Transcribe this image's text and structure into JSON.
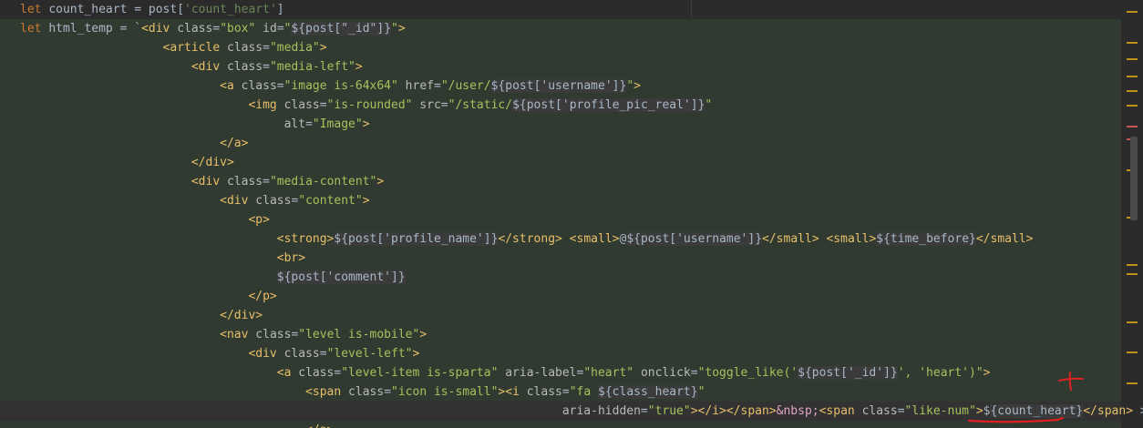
{
  "editor": {
    "lines": [
      [
        [
          "kw",
          "let "
        ],
        [
          "var",
          "count_heart"
        ],
        [
          "pun",
          " = "
        ],
        [
          "var",
          "post"
        ],
        [
          "pun",
          "["
        ],
        [
          "str",
          "'count_heart'"
        ],
        [
          "pun",
          "]"
        ]
      ],
      [
        [
          "kw",
          "let "
        ],
        [
          "var",
          "html_temp"
        ],
        [
          "pun",
          " = `"
        ],
        [
          "tag",
          "<div "
        ],
        [
          "attr",
          "class"
        ],
        [
          "pun",
          "="
        ],
        [
          "val",
          "\"box\""
        ],
        [
          "attr",
          " id"
        ],
        [
          "pun",
          "="
        ],
        [
          "val",
          "\""
        ],
        [
          "sub",
          "${post[\"_id\"]}"
        ],
        [
          "val",
          "\""
        ],
        [
          "tag",
          ">"
        ]
      ],
      [
        [
          "pun",
          "                    "
        ],
        [
          "tag",
          "<article "
        ],
        [
          "attr",
          "class"
        ],
        [
          "pun",
          "="
        ],
        [
          "val",
          "\"media\""
        ],
        [
          "tag",
          ">"
        ]
      ],
      [
        [
          "pun",
          "                        "
        ],
        [
          "tag",
          "<div "
        ],
        [
          "attr",
          "class"
        ],
        [
          "pun",
          "="
        ],
        [
          "val",
          "\"media-left\""
        ],
        [
          "tag",
          ">"
        ]
      ],
      [
        [
          "pun",
          "                            "
        ],
        [
          "tag",
          "<a "
        ],
        [
          "attr",
          "class"
        ],
        [
          "pun",
          "="
        ],
        [
          "val",
          "\"image is-64x64\""
        ],
        [
          "attr",
          " href"
        ],
        [
          "pun",
          "="
        ],
        [
          "val",
          "\"/user/"
        ],
        [
          "sub",
          "${post['username']}"
        ],
        [
          "val",
          "\""
        ],
        [
          "tag",
          ">"
        ]
      ],
      [
        [
          "pun",
          "                                "
        ],
        [
          "tag",
          "<img "
        ],
        [
          "attr",
          "class"
        ],
        [
          "pun",
          "="
        ],
        [
          "val",
          "\"is-rounded\""
        ],
        [
          "attr",
          " src"
        ],
        [
          "pun",
          "="
        ],
        [
          "val",
          "\"/static/"
        ],
        [
          "sub",
          "${post['profile_pic_real']}"
        ],
        [
          "val",
          "\""
        ]
      ],
      [
        [
          "pun",
          "                                     "
        ],
        [
          "attr",
          "alt"
        ],
        [
          "pun",
          "="
        ],
        [
          "val",
          "\"Image\""
        ],
        [
          "tag",
          ">"
        ]
      ],
      [
        [
          "pun",
          "                            "
        ],
        [
          "tag",
          "</a>"
        ]
      ],
      [
        [
          "pun",
          "                        "
        ],
        [
          "tag",
          "</div>"
        ]
      ],
      [
        [
          "pun",
          "                        "
        ],
        [
          "tag",
          "<div "
        ],
        [
          "attr",
          "class"
        ],
        [
          "pun",
          "="
        ],
        [
          "val",
          "\"media-content\""
        ],
        [
          "tag",
          ">"
        ]
      ],
      [
        [
          "pun",
          "                            "
        ],
        [
          "tag",
          "<div "
        ],
        [
          "attr",
          "class"
        ],
        [
          "pun",
          "="
        ],
        [
          "val",
          "\"content\""
        ],
        [
          "tag",
          ">"
        ]
      ],
      [
        [
          "pun",
          "                                "
        ],
        [
          "tag",
          "<p>"
        ]
      ],
      [
        [
          "pun",
          "                                    "
        ],
        [
          "tag",
          "<strong>"
        ],
        [
          "sub",
          "${post['profile_name']}"
        ],
        [
          "tag",
          "</strong>"
        ],
        [
          "pun",
          " "
        ],
        [
          "tag",
          "<small>"
        ],
        [
          "pun",
          "@"
        ],
        [
          "sub",
          "${post['username']}"
        ],
        [
          "tag",
          "</small>"
        ],
        [
          "pun",
          " "
        ],
        [
          "tag",
          "<small>"
        ],
        [
          "sub",
          "${time_before}"
        ],
        [
          "tag",
          "</small>"
        ]
      ],
      [
        [
          "pun",
          "                                    "
        ],
        [
          "tag",
          "<br>"
        ]
      ],
      [
        [
          "pun",
          "                                    "
        ],
        [
          "sub",
          "${post['comment']}"
        ]
      ],
      [
        [
          "pun",
          "                                "
        ],
        [
          "tag",
          "</p>"
        ]
      ],
      [
        [
          "pun",
          "                            "
        ],
        [
          "tag",
          "</div>"
        ]
      ],
      [
        [
          "pun",
          "                            "
        ],
        [
          "tag",
          "<nav "
        ],
        [
          "attr",
          "class"
        ],
        [
          "pun",
          "="
        ],
        [
          "val",
          "\"level is-mobile\""
        ],
        [
          "tag",
          ">"
        ]
      ],
      [
        [
          "pun",
          "                                "
        ],
        [
          "tag",
          "<div "
        ],
        [
          "attr",
          "class"
        ],
        [
          "pun",
          "="
        ],
        [
          "val",
          "\"level-left\""
        ],
        [
          "tag",
          ">"
        ]
      ],
      [
        [
          "pun",
          "                                    "
        ],
        [
          "tag",
          "<a "
        ],
        [
          "attr",
          "class"
        ],
        [
          "pun",
          "="
        ],
        [
          "val",
          "\"level-item is-sparta\""
        ],
        [
          "attr",
          " aria-label"
        ],
        [
          "pun",
          "="
        ],
        [
          "val",
          "\"heart\""
        ],
        [
          "attr",
          " onclick"
        ],
        [
          "pun",
          "="
        ],
        [
          "val",
          "\"toggle_like('"
        ],
        [
          "sub",
          "${post['_id']}"
        ],
        [
          "val",
          "', 'heart')\""
        ],
        [
          "tag",
          ">"
        ]
      ],
      [
        [
          "pun",
          "                                        "
        ],
        [
          "tag",
          "<span "
        ],
        [
          "attr",
          "class"
        ],
        [
          "pun",
          "="
        ],
        [
          "val",
          "\"icon is-small\""
        ],
        [
          "tag",
          ">"
        ],
        [
          "tag",
          "<i "
        ],
        [
          "attr",
          "class"
        ],
        [
          "pun",
          "="
        ],
        [
          "val",
          "\"fa "
        ],
        [
          "sub",
          "${class_heart}"
        ],
        [
          "val",
          "\""
        ]
      ],
      [
        [
          "pun",
          "                                                                            "
        ],
        [
          "attr",
          "aria-hidden"
        ],
        [
          "pun",
          "="
        ],
        [
          "val",
          "\"true\""
        ],
        [
          "tag",
          "></i></span>"
        ],
        [
          "ent",
          "&nbsp;"
        ],
        [
          "tag",
          "<span "
        ],
        [
          "attr",
          "class"
        ],
        [
          "pun",
          "="
        ],
        [
          "val",
          "\"like-num\""
        ],
        [
          "tag",
          ">"
        ],
        [
          "pun",
          "$"
        ],
        [
          "sub",
          "{count_heart}"
        ],
        [
          "tag",
          "</span>"
        ],
        [
          "pun",
          " >"
        ]
      ],
      [
        [
          "pun",
          "                                        "
        ],
        [
          "tag",
          "</a>"
        ]
      ]
    ],
    "line_styles": [
      "plain",
      "tpl",
      "tpl",
      "tpl",
      "tpl",
      "tpl",
      "tpl",
      "tpl",
      "tpl",
      "tpl",
      "tpl",
      "tpl",
      "tpl",
      "tpl",
      "tpl",
      "tpl",
      "tpl",
      "tpl",
      "tpl",
      "tpl",
      "tpl",
      "hl",
      "tpl"
    ],
    "markers": [
      {
        "color": "#be9117"
      },
      {
        "color": "#be9117"
      },
      {
        "color": "#be9117"
      },
      {
        "color": "#be9117"
      },
      {
        "color": "#be9117"
      },
      {
        "color": "#be9117"
      },
      {
        "color": "#c75450"
      },
      {
        "color": "#c75450"
      },
      {
        "color": "#be9117"
      },
      {
        "color": "#be9117"
      },
      {
        "color": "#be9117"
      },
      {
        "color": "#be9117"
      },
      {
        "color": "#be9117"
      },
      {
        "color": "#be9117"
      },
      {
        "color": "#be9117"
      }
    ],
    "annotation_color": "#e02020"
  }
}
